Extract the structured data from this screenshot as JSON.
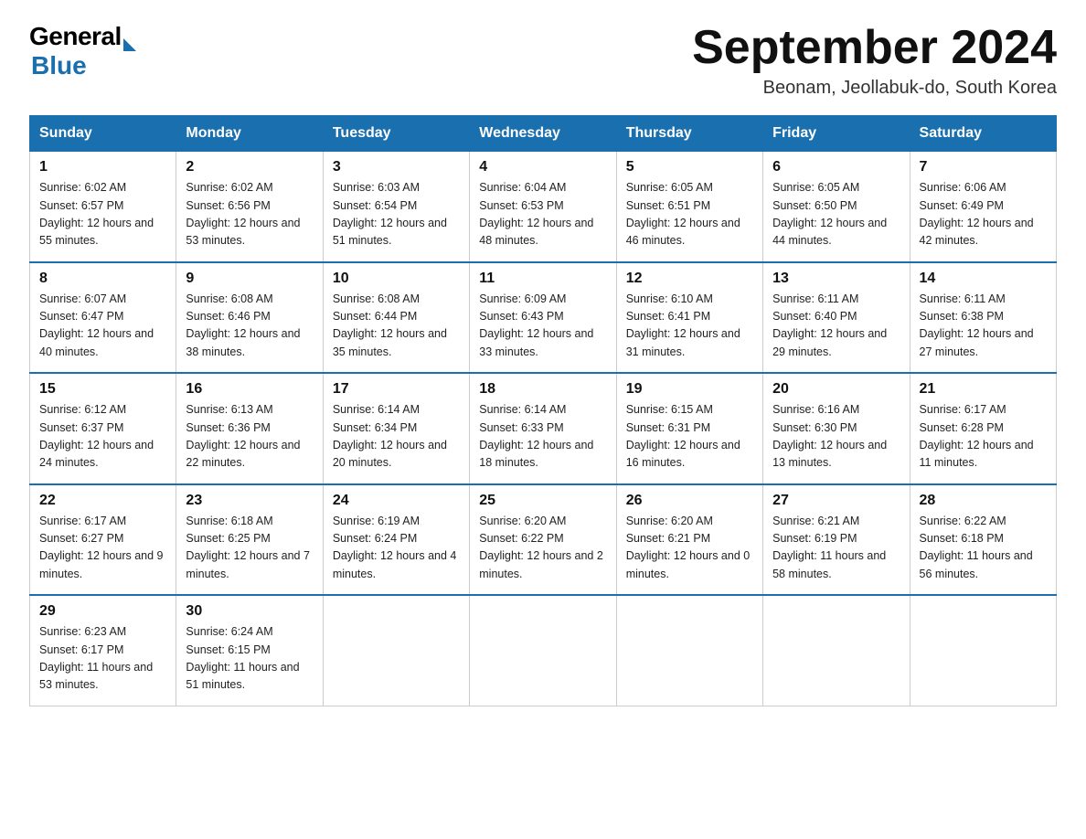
{
  "header": {
    "logo_general": "General",
    "logo_blue": "Blue",
    "title": "September 2024",
    "subtitle": "Beonam, Jeollabuk-do, South Korea"
  },
  "weekdays": [
    "Sunday",
    "Monday",
    "Tuesday",
    "Wednesday",
    "Thursday",
    "Friday",
    "Saturday"
  ],
  "weeks": [
    [
      {
        "day": "1",
        "sunrise": "6:02 AM",
        "sunset": "6:57 PM",
        "daylight": "12 hours and 55 minutes."
      },
      {
        "day": "2",
        "sunrise": "6:02 AM",
        "sunset": "6:56 PM",
        "daylight": "12 hours and 53 minutes."
      },
      {
        "day": "3",
        "sunrise": "6:03 AM",
        "sunset": "6:54 PM",
        "daylight": "12 hours and 51 minutes."
      },
      {
        "day": "4",
        "sunrise": "6:04 AM",
        "sunset": "6:53 PM",
        "daylight": "12 hours and 48 minutes."
      },
      {
        "day": "5",
        "sunrise": "6:05 AM",
        "sunset": "6:51 PM",
        "daylight": "12 hours and 46 minutes."
      },
      {
        "day": "6",
        "sunrise": "6:05 AM",
        "sunset": "6:50 PM",
        "daylight": "12 hours and 44 minutes."
      },
      {
        "day": "7",
        "sunrise": "6:06 AM",
        "sunset": "6:49 PM",
        "daylight": "12 hours and 42 minutes."
      }
    ],
    [
      {
        "day": "8",
        "sunrise": "6:07 AM",
        "sunset": "6:47 PM",
        "daylight": "12 hours and 40 minutes."
      },
      {
        "day": "9",
        "sunrise": "6:08 AM",
        "sunset": "6:46 PM",
        "daylight": "12 hours and 38 minutes."
      },
      {
        "day": "10",
        "sunrise": "6:08 AM",
        "sunset": "6:44 PM",
        "daylight": "12 hours and 35 minutes."
      },
      {
        "day": "11",
        "sunrise": "6:09 AM",
        "sunset": "6:43 PM",
        "daylight": "12 hours and 33 minutes."
      },
      {
        "day": "12",
        "sunrise": "6:10 AM",
        "sunset": "6:41 PM",
        "daylight": "12 hours and 31 minutes."
      },
      {
        "day": "13",
        "sunrise": "6:11 AM",
        "sunset": "6:40 PM",
        "daylight": "12 hours and 29 minutes."
      },
      {
        "day": "14",
        "sunrise": "6:11 AM",
        "sunset": "6:38 PM",
        "daylight": "12 hours and 27 minutes."
      }
    ],
    [
      {
        "day": "15",
        "sunrise": "6:12 AM",
        "sunset": "6:37 PM",
        "daylight": "12 hours and 24 minutes."
      },
      {
        "day": "16",
        "sunrise": "6:13 AM",
        "sunset": "6:36 PM",
        "daylight": "12 hours and 22 minutes."
      },
      {
        "day": "17",
        "sunrise": "6:14 AM",
        "sunset": "6:34 PM",
        "daylight": "12 hours and 20 minutes."
      },
      {
        "day": "18",
        "sunrise": "6:14 AM",
        "sunset": "6:33 PM",
        "daylight": "12 hours and 18 minutes."
      },
      {
        "day": "19",
        "sunrise": "6:15 AM",
        "sunset": "6:31 PM",
        "daylight": "12 hours and 16 minutes."
      },
      {
        "day": "20",
        "sunrise": "6:16 AM",
        "sunset": "6:30 PM",
        "daylight": "12 hours and 13 minutes."
      },
      {
        "day": "21",
        "sunrise": "6:17 AM",
        "sunset": "6:28 PM",
        "daylight": "12 hours and 11 minutes."
      }
    ],
    [
      {
        "day": "22",
        "sunrise": "6:17 AM",
        "sunset": "6:27 PM",
        "daylight": "12 hours and 9 minutes."
      },
      {
        "day": "23",
        "sunrise": "6:18 AM",
        "sunset": "6:25 PM",
        "daylight": "12 hours and 7 minutes."
      },
      {
        "day": "24",
        "sunrise": "6:19 AM",
        "sunset": "6:24 PM",
        "daylight": "12 hours and 4 minutes."
      },
      {
        "day": "25",
        "sunrise": "6:20 AM",
        "sunset": "6:22 PM",
        "daylight": "12 hours and 2 minutes."
      },
      {
        "day": "26",
        "sunrise": "6:20 AM",
        "sunset": "6:21 PM",
        "daylight": "12 hours and 0 minutes."
      },
      {
        "day": "27",
        "sunrise": "6:21 AM",
        "sunset": "6:19 PM",
        "daylight": "11 hours and 58 minutes."
      },
      {
        "day": "28",
        "sunrise": "6:22 AM",
        "sunset": "6:18 PM",
        "daylight": "11 hours and 56 minutes."
      }
    ],
    [
      {
        "day": "29",
        "sunrise": "6:23 AM",
        "sunset": "6:17 PM",
        "daylight": "11 hours and 53 minutes."
      },
      {
        "day": "30",
        "sunrise": "6:24 AM",
        "sunset": "6:15 PM",
        "daylight": "11 hours and 51 minutes."
      },
      null,
      null,
      null,
      null,
      null
    ]
  ]
}
